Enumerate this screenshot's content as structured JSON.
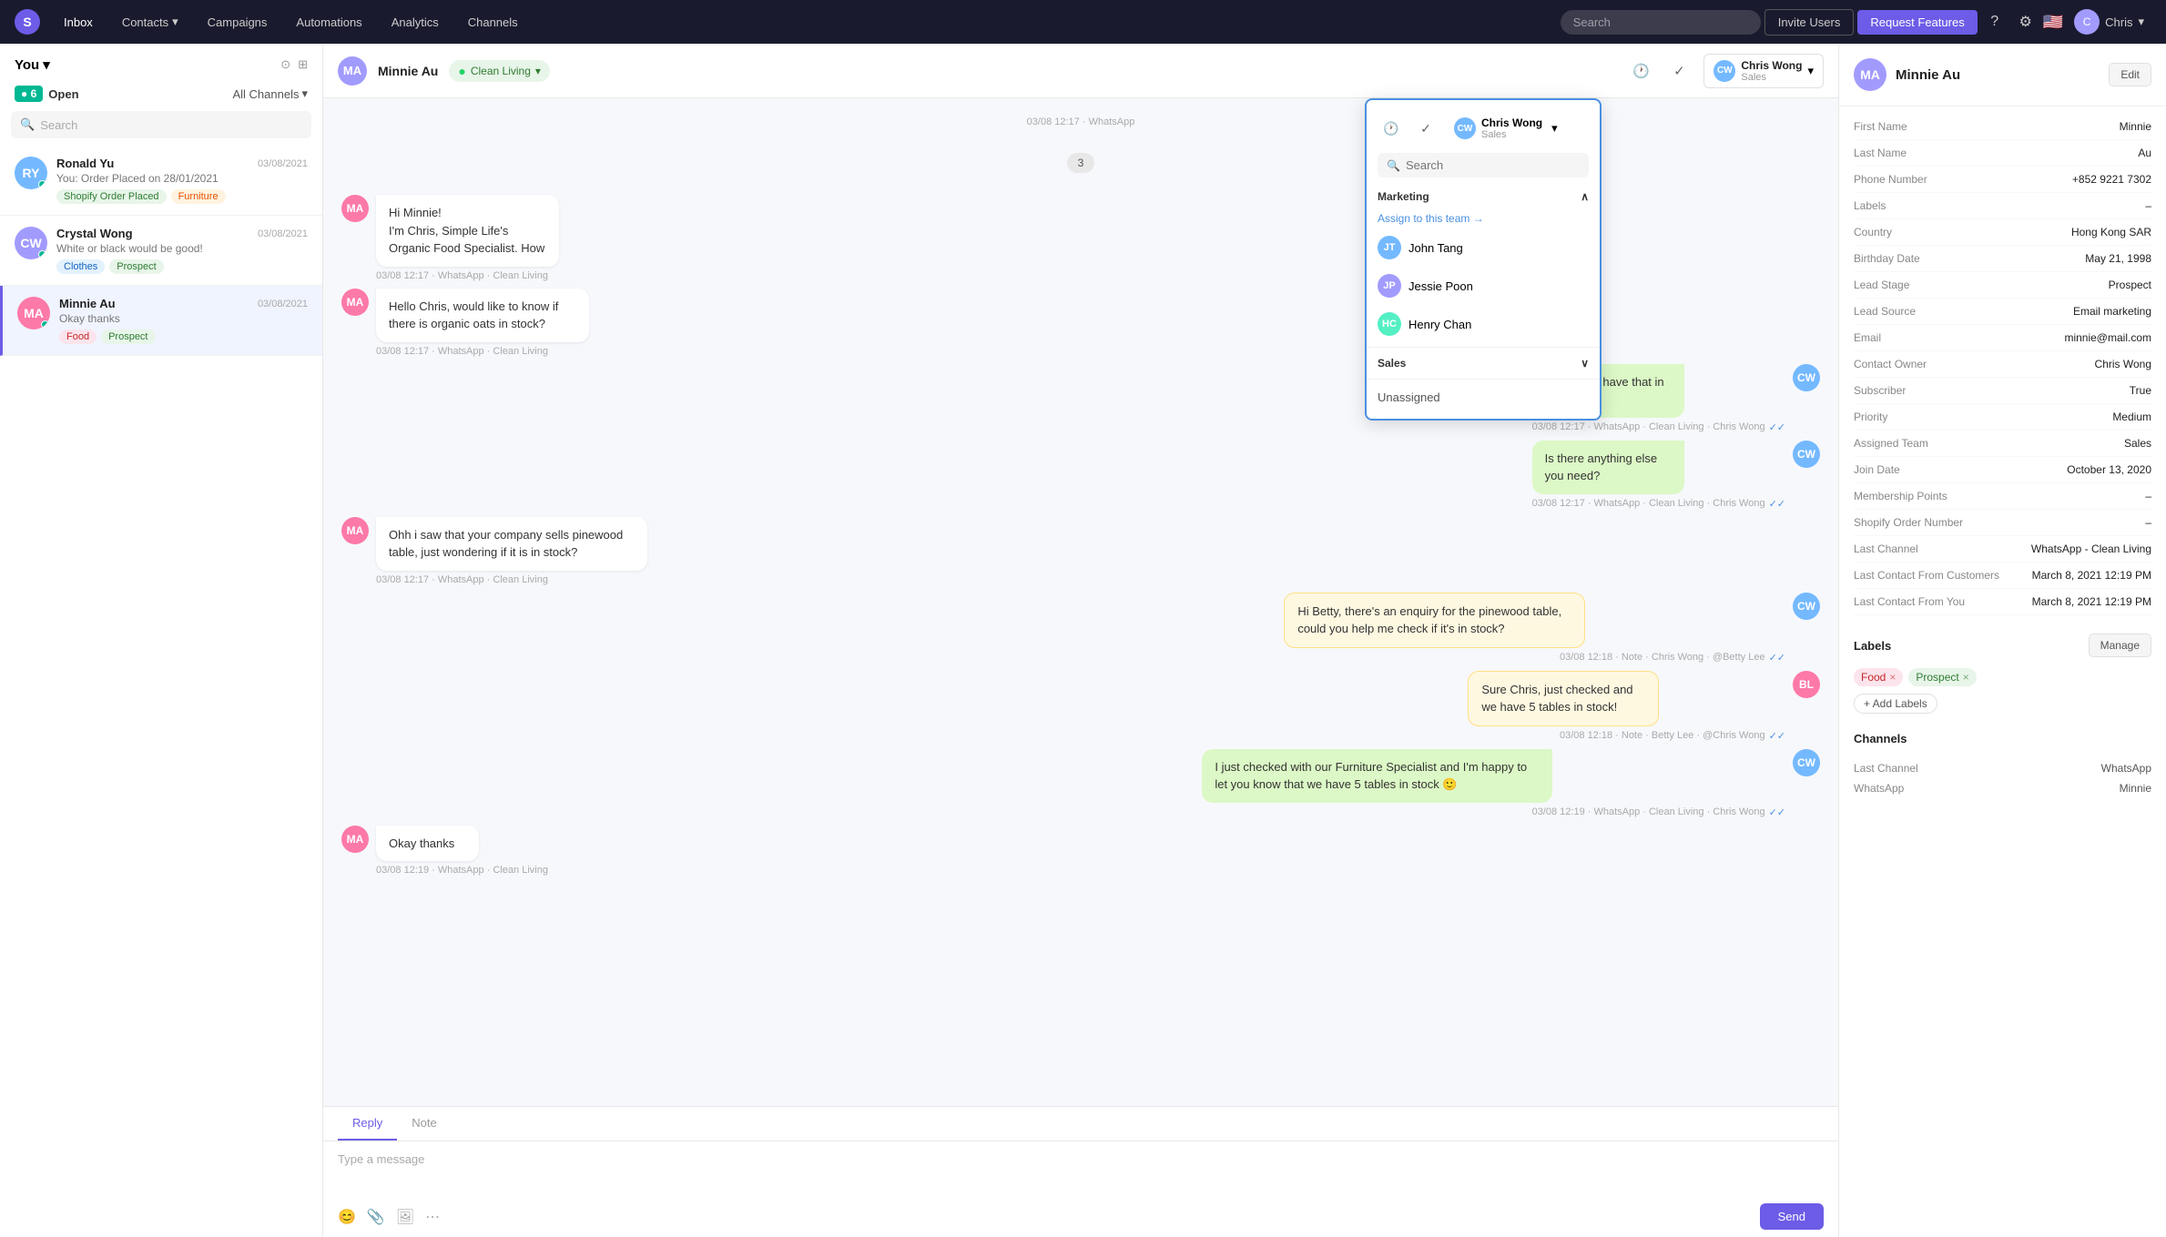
{
  "app": {
    "logo": "S",
    "nav_items": [
      "Inbox",
      "Contacts",
      "Campaigns",
      "Automations",
      "Analytics",
      "Channels"
    ],
    "nav_active": "Inbox",
    "search_placeholder": "Search",
    "invite_label": "Invite Users",
    "request_label": "Request Features",
    "user_name": "Chris"
  },
  "sidebar": {
    "you_label": "You",
    "open_label": "Open",
    "open_count": "6",
    "all_channels_label": "All Channels",
    "search_placeholder": "Search",
    "conversations": [
      {
        "id": 1,
        "name": "Ronald Yu",
        "time": "03/08/2021",
        "preview": "You: Order Placed on 28/01/2021",
        "tags": [
          "Shopify Order Placed",
          "Furniture"
        ],
        "tag_classes": [
          "tag-shopify",
          "tag-furniture"
        ],
        "initials": "RY",
        "avatar_color": "#74b9ff",
        "active": false
      },
      {
        "id": 2,
        "name": "Crystal Wong",
        "time": "03/08/2021",
        "preview": "White or black would be good!",
        "tags": [
          "Clothes",
          "Prospect"
        ],
        "tag_classes": [
          "tag-clothes",
          "tag-prospect"
        ],
        "initials": "CW",
        "avatar_color": "#a29bfe",
        "active": false
      },
      {
        "id": 3,
        "name": "Minnie Au",
        "time": "03/08/2021",
        "preview": "Okay thanks",
        "tags": [
          "Food",
          "Prospect"
        ],
        "tag_classes": [
          "tag-food",
          "tag-prospect"
        ],
        "initials": "MA",
        "avatar_color": "#fd79a8",
        "active": true
      }
    ]
  },
  "chat": {
    "contact_name": "Minnie Au",
    "contact_initials": "MA",
    "whatsapp_channel": "Clean Living",
    "header_actions": [
      "clock-icon",
      "check-icon"
    ],
    "assignee": {
      "name": "Chris Wong",
      "role": "Sales",
      "initials": "CW"
    },
    "messages": [
      {
        "type": "system",
        "text": "03/08 12:17",
        "channel": "WhatsApp"
      },
      {
        "type": "number",
        "value": "3"
      },
      {
        "type": "received",
        "text": "Hi Minnie!\nI'm Chris, Simple Life's Organic Food Specialist. How",
        "time": "03/08 12:17",
        "channel": "WhatsApp",
        "channelLabel": "Clean Living",
        "initials": "MA"
      },
      {
        "type": "received",
        "text": "Hello Chris, would like to know if there is organic oats in stock?",
        "time": "03/08 12:17",
        "channel": "WhatsApp",
        "channelLabel": "Clean Living",
        "initials": "MA"
      },
      {
        "type": "sent",
        "text": "You we do have that in stock!",
        "time": "03/08 12:17",
        "channel": "WhatsApp",
        "channelLabel": "Clean Living",
        "agent": "Chris Wong"
      },
      {
        "type": "sent",
        "text": "Is there anything else you need?",
        "time": "03/08 12:17",
        "channel": "WhatsApp",
        "channelLabel": "Clean Living",
        "agent": "Chris Wong"
      },
      {
        "type": "received",
        "text": "Ohh i saw that your company sells pinewood table, just wondering if it is in stock?",
        "time": "03/08 12:17",
        "channel": "WhatsApp",
        "channelLabel": "Clean Living",
        "initials": "MA"
      },
      {
        "type": "note",
        "text": "Hi Betty, there's an enquiry for the pinewood table, could you help me check if it's in stock?",
        "time": "03/08 12:18",
        "noteType": "Note",
        "agent": "Chris Wong",
        "mention": "@Betty Lee"
      },
      {
        "type": "note",
        "text": "Sure Chris, just checked and we have 5 tables in stock!",
        "time": "03/08 12:18",
        "noteType": "Note",
        "agent": "Betty Lee",
        "mention": "@Chris Wong"
      },
      {
        "type": "sent",
        "text": "I just checked with our Furniture Specialist and I'm happy to let you know that we have 5 tables in stock 🙂",
        "time": "03/08 12:19",
        "channel": "WhatsApp",
        "channelLabel": "Clean Living",
        "agent": "Chris Wong"
      },
      {
        "type": "received",
        "text": "Okay thanks",
        "time": "03/08 12:19",
        "channel": "WhatsApp",
        "channelLabel": "Clean Living",
        "initials": "MA"
      }
    ],
    "input_tabs": [
      "Reply",
      "Note"
    ],
    "active_tab": "Reply",
    "input_placeholder": "Type a message",
    "send_label": "Send"
  },
  "dropdown": {
    "header_icons": [
      "clock",
      "check"
    ],
    "assignee_name": "Chris Wong",
    "assignee_role": "Sales",
    "search_placeholder": "Search",
    "sections": [
      {
        "title": "Marketing",
        "assign_team_label": "Assign to this team →",
        "agents": [
          "John Tang",
          "Jessie Poon",
          "Henry Chan"
        ]
      },
      {
        "title": "Sales",
        "agents": []
      }
    ],
    "unassigned_label": "Unassigned"
  },
  "right_panel": {
    "contact_name": "Minnie Au",
    "contact_initials": "MA",
    "edit_label": "Edit",
    "fields": [
      {
        "label": "First Name",
        "value": "Minnie"
      },
      {
        "label": "Last Name",
        "value": "Au"
      },
      {
        "label": "Phone Number",
        "value": "+852 9221 7302"
      },
      {
        "label": "Labels",
        "value": "–"
      },
      {
        "label": "Country",
        "value": "Hong Kong SAR"
      },
      {
        "label": "Birthday Date",
        "value": "May 21, 1998"
      },
      {
        "label": "Lead Stage",
        "value": "Prospect"
      },
      {
        "label": "Lead Source",
        "value": "Email marketing"
      },
      {
        "label": "Email",
        "value": "minnie@mail.com"
      },
      {
        "label": "Contact Owner",
        "value": "Chris Wong"
      },
      {
        "label": "Subscriber",
        "value": "True"
      },
      {
        "label": "Priority",
        "value": "Medium"
      },
      {
        "label": "Assigned Team",
        "value": "Sales"
      },
      {
        "label": "Join Date",
        "value": "October 13, 2020"
      },
      {
        "label": "Membership Points",
        "value": "–"
      },
      {
        "label": "Shopify Order Number",
        "value": "–"
      },
      {
        "label": "Last Channel",
        "value": "WhatsApp - Clean Living"
      },
      {
        "label": "Last Contact From Customers",
        "value": "March 8, 2021 12:19 PM"
      },
      {
        "label": "Last Contact From You",
        "value": "March 8, 2021 12:19 PM"
      }
    ],
    "labels_title": "Labels",
    "manage_label": "Manage",
    "labels": [
      {
        "text": "Food",
        "class": "label-food"
      },
      {
        "text": "Prospect",
        "class": "label-prospect"
      }
    ],
    "add_label": "+ Add Labels",
    "channels_title": "Channels",
    "channel_fields": [
      {
        "label": "Last Channel",
        "value": "WhatsApp"
      },
      {
        "label": "WhatsApp",
        "value": "Minnie"
      }
    ]
  }
}
